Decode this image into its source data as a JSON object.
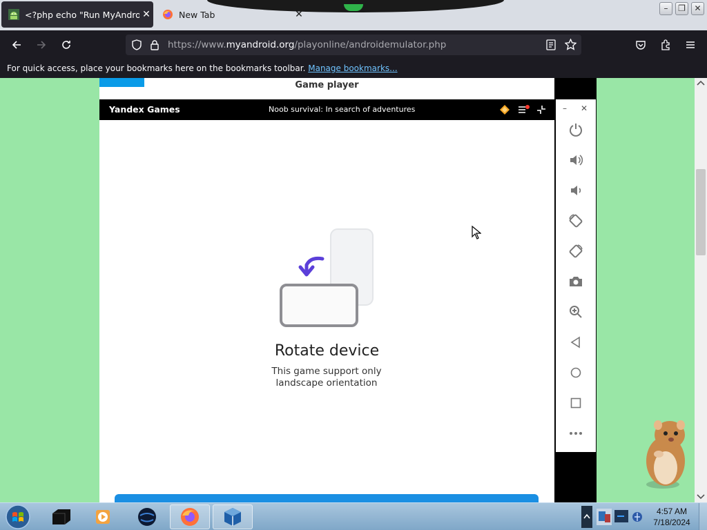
{
  "browser": {
    "tabs": [
      {
        "title": "<?php echo \"Run MyAndroid\";",
        "close": "✕"
      },
      {
        "title": "New Tab",
        "close": "✕"
      }
    ],
    "url_prefix": "https://www.",
    "url_domain": "myandroid.org",
    "url_path": "/playonline/androidemulator.php",
    "bookmarks_text": "For quick access, place your bookmarks here on the bookmarks toolbar.",
    "bookmarks_link": "Manage bookmarks...",
    "window_buttons": {
      "minimize": "–",
      "restore": "❐",
      "close": "✕"
    }
  },
  "page": {
    "title": "Game player",
    "yandex_brand": "Yandex Games",
    "game_name": "Noob survival: In search of adventures",
    "rotate_title": "Rotate device",
    "rotate_desc": "This game support only landscape orientation"
  },
  "emulator_panel": {
    "window_controls": {
      "minimize": "–",
      "close": "✕"
    },
    "buttons": [
      "power-icon",
      "volume-up-icon",
      "volume-down-icon",
      "rotate-left-icon",
      "rotate-right-icon",
      "camera-icon",
      "zoom-icon",
      "back-icon",
      "home-icon",
      "overview-icon",
      "more-icon"
    ]
  },
  "taskbar": {
    "time": "4:57 AM",
    "date": "7/18/2024"
  },
  "colors": {
    "page_bg": "#99e6a6",
    "browser_dark": "#1c1b22",
    "accent_blue": "#0a9be8",
    "rotate_arrow": "#5b3fd9"
  }
}
